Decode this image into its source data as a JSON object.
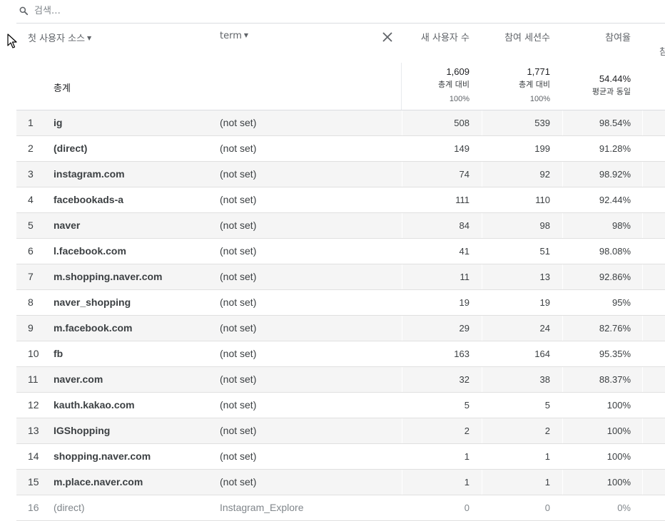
{
  "search": {
    "placeholder": "검색…"
  },
  "columns": {
    "dimension1": "첫 사용자 소스",
    "dimension2": "term",
    "metric1": "새 사용자 수",
    "metric2": "참여 세션수",
    "metric3": "참여율",
    "metric4_cut": "참"
  },
  "totals": {
    "label": "총계",
    "metric1": {
      "value": "1,609",
      "caption": "총계 대비",
      "pct": "100%"
    },
    "metric2": {
      "value": "1,771",
      "caption": "총계 대비",
      "pct": "100%"
    },
    "metric3": {
      "value": "54.44%",
      "caption": "평균과 동일"
    }
  },
  "rows": [
    {
      "idx": "1",
      "source": "ig",
      "term": "(not set)",
      "new_users": "508",
      "sessions": "539",
      "rate": "98.54%"
    },
    {
      "idx": "2",
      "source": "(direct)",
      "term": "(not set)",
      "new_users": "149",
      "sessions": "199",
      "rate": "91.28%"
    },
    {
      "idx": "3",
      "source": "instagram.com",
      "term": "(not set)",
      "new_users": "74",
      "sessions": "92",
      "rate": "98.92%"
    },
    {
      "idx": "4",
      "source": "facebookads-a",
      "term": "(not set)",
      "new_users": "111",
      "sessions": "110",
      "rate": "92.44%"
    },
    {
      "idx": "5",
      "source": "naver",
      "term": "(not set)",
      "new_users": "84",
      "sessions": "98",
      "rate": "98%"
    },
    {
      "idx": "6",
      "source": "l.facebook.com",
      "term": "(not set)",
      "new_users": "41",
      "sessions": "51",
      "rate": "98.08%"
    },
    {
      "idx": "7",
      "source": "m.shopping.naver.com",
      "term": "(not set)",
      "new_users": "11",
      "sessions": "13",
      "rate": "92.86%"
    },
    {
      "idx": "8",
      "source": "naver_shopping",
      "term": "(not set)",
      "new_users": "19",
      "sessions": "19",
      "rate": "95%"
    },
    {
      "idx": "9",
      "source": "m.facebook.com",
      "term": "(not set)",
      "new_users": "29",
      "sessions": "24",
      "rate": "82.76%"
    },
    {
      "idx": "10",
      "source": "fb",
      "term": "(not set)",
      "new_users": "163",
      "sessions": "164",
      "rate": "95.35%"
    },
    {
      "idx": "11",
      "source": "naver.com",
      "term": "(not set)",
      "new_users": "32",
      "sessions": "38",
      "rate": "88.37%"
    },
    {
      "idx": "12",
      "source": "kauth.kakao.com",
      "term": "(not set)",
      "new_users": "5",
      "sessions": "5",
      "rate": "100%"
    },
    {
      "idx": "13",
      "source": "IGShopping",
      "term": "(not set)",
      "new_users": "2",
      "sessions": "2",
      "rate": "100%"
    },
    {
      "idx": "14",
      "source": "shopping.naver.com",
      "term": "(not set)",
      "new_users": "1",
      "sessions": "1",
      "rate": "100%"
    },
    {
      "idx": "15",
      "source": "m.place.naver.com",
      "term": "(not set)",
      "new_users": "1",
      "sessions": "1",
      "rate": "100%"
    },
    {
      "idx": "16",
      "source": "(direct)",
      "term": "Instagram_Explore",
      "new_users": "0",
      "sessions": "0",
      "rate": "0%"
    }
  ]
}
